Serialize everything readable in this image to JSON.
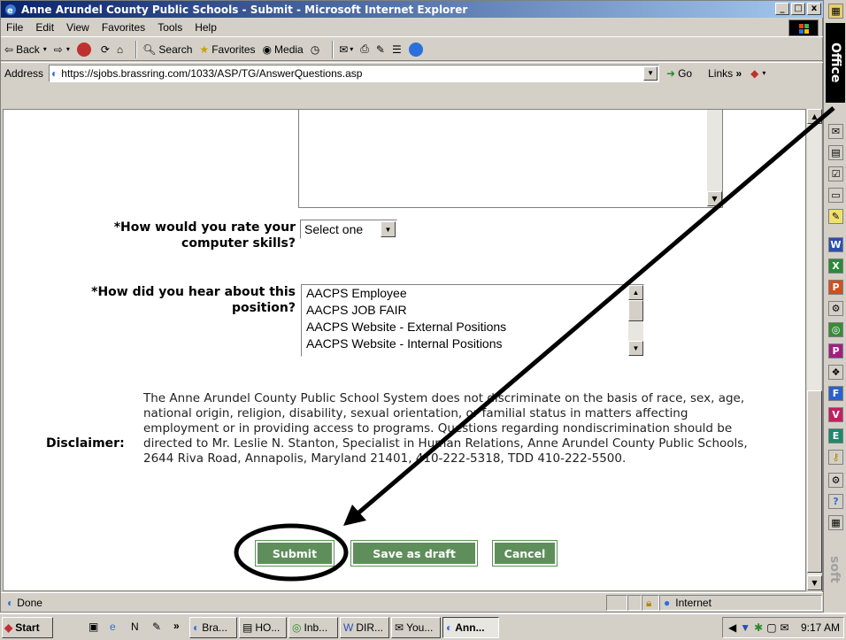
{
  "window": {
    "title": "Anne Arundel County Public Schools - Submit - Microsoft Internet Explorer",
    "controls": {
      "minimize": "_",
      "maximize": "□",
      "close": "x"
    }
  },
  "menu": [
    "File",
    "Edit",
    "View",
    "Favorites",
    "Tools",
    "Help"
  ],
  "toolbar": {
    "back": "Back",
    "search": "Search",
    "favorites": "Favorites",
    "media": "Media"
  },
  "address": {
    "label": "Address",
    "url": "https://sjobs.brassring.com/1033/ASP/TG/AnswerQuestions.asp",
    "go": "Go",
    "links": "Links"
  },
  "form": {
    "q_rate": {
      "label_line1": "*How would you rate your",
      "label_line2": "computer skills?",
      "selected": "Select one"
    },
    "q_hear": {
      "label_line1": "*How did you hear about this",
      "label_line2": "position?",
      "options": [
        "AACPS Employee",
        "AACPS JOB FAIR",
        "AACPS Website - External Positions",
        "AACPS Website - Internal Positions"
      ]
    },
    "disclaimer_label": "Disclaimer:",
    "disclaimer_text": "The Anne Arundel County Public School System does not discriminate on the basis of race, sex, age, national origin, religion, disability, sexual orientation, or familial status in matters affecting employment or in providing access to programs. Questions regarding nondiscrimination should be directed to Mr. Leslie N. Stanton, Specialist in Human Relations, Anne Arundel County Public Schools, 2644 Riva Road, Annapolis, Maryland 21401, 410-222-5318, TDD 410-222-5500.",
    "buttons": {
      "submit": "Submit",
      "draft": "Save as draft",
      "cancel": "Cancel"
    },
    "button_color": "#5e8f5a"
  },
  "statusbar": {
    "text": "Done",
    "zone": "Internet"
  },
  "officebar": {
    "label": "Office",
    "footer": "soft"
  },
  "taskbar": {
    "start": "Start",
    "tasks": [
      "Bra...",
      "HO...",
      "Inb...",
      "DIR...",
      "You...",
      "Ann..."
    ],
    "clock": "9:17 AM"
  },
  "annotation": {
    "color": "#000000"
  }
}
